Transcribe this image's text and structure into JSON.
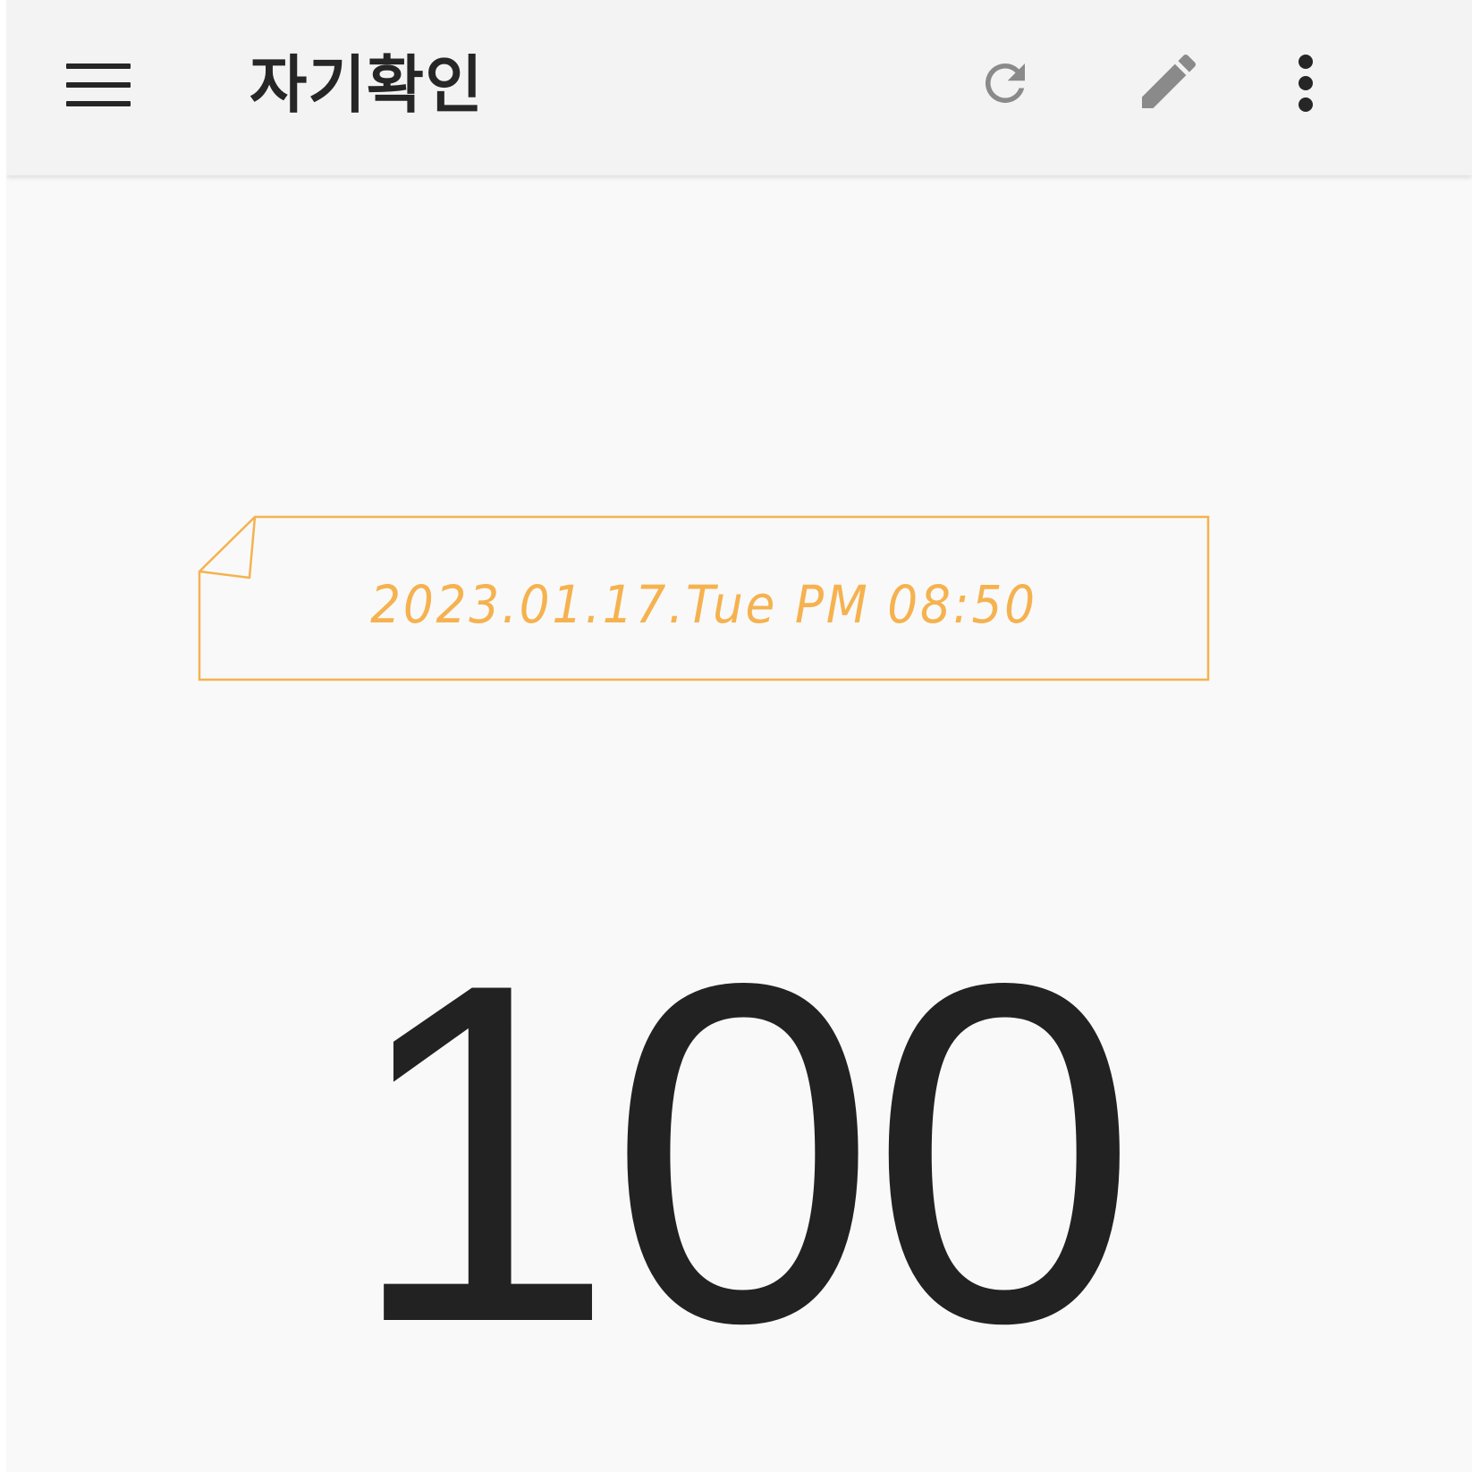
{
  "app_bar": {
    "title": "자기확인",
    "menu_icon": "hamburger-menu-icon",
    "refresh_icon": "refresh-icon",
    "edit_icon": "pencil-icon",
    "more_icon": "more-vertical-icon"
  },
  "note": {
    "datetime": "2023.01.17.Tue PM 08:50",
    "accent_color": "#f5b24f"
  },
  "counter": {
    "value": "100"
  },
  "colors": {
    "app_bar_bg": "#f3f3f3",
    "page_bg": "#f9f9f9",
    "text_dark": "#222222",
    "icon_gray": "#8a8a8a"
  }
}
